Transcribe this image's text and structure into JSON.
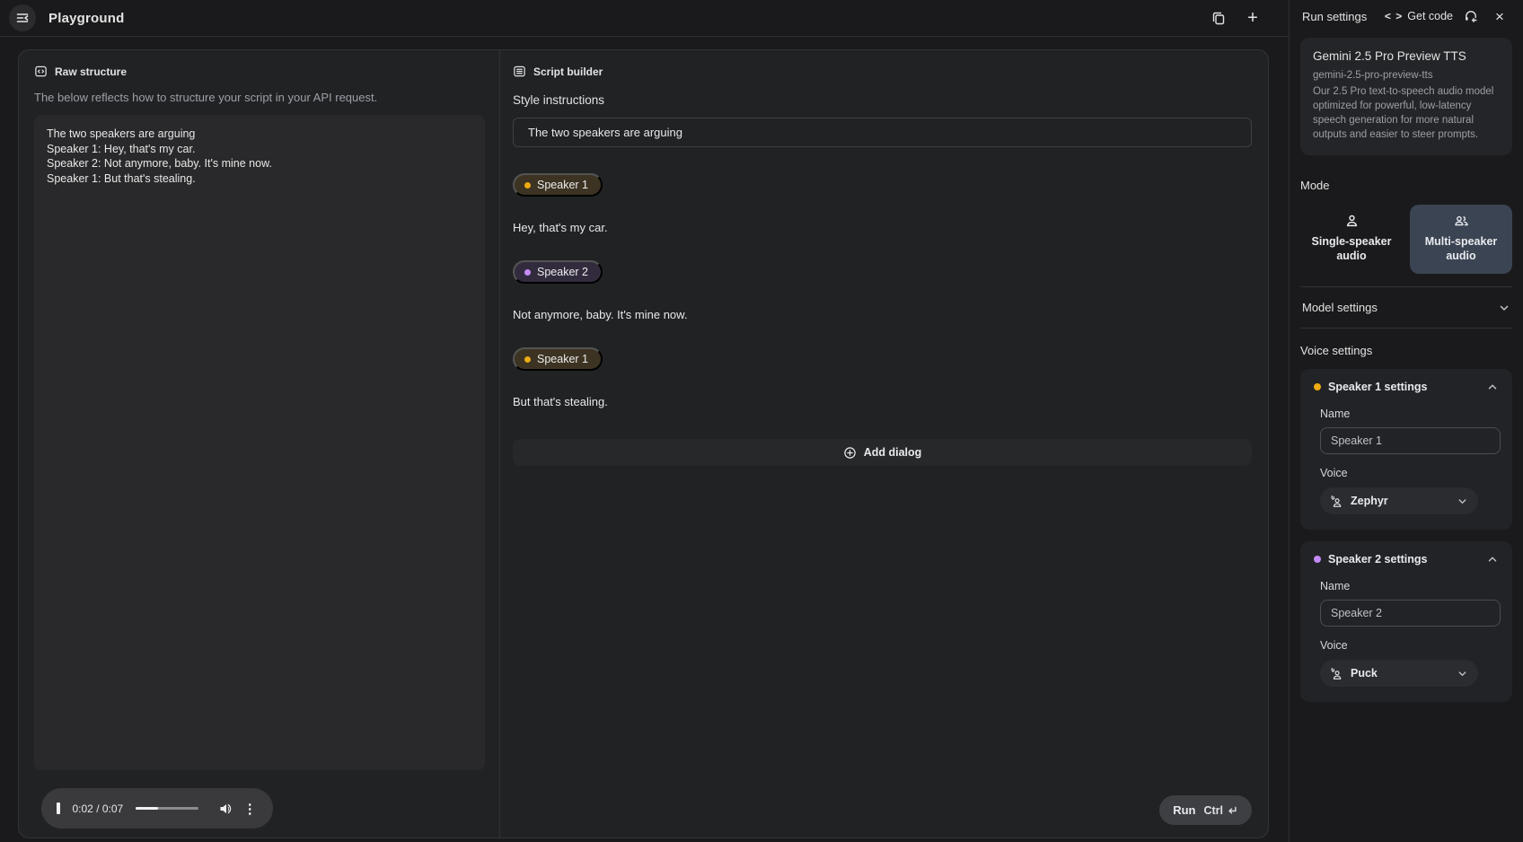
{
  "header": {
    "title": "Playground"
  },
  "raw_structure": {
    "title": "Raw structure",
    "description": "The below reflects how to structure your script in your API request.",
    "lines": [
      "The two speakers are arguing",
      "Speaker 1: Hey, that's my car.",
      "Speaker 2: Not anymore, baby. It's mine now.",
      "Speaker 1: But that's stealing."
    ]
  },
  "script_builder": {
    "title": "Script builder",
    "style_label": "Style instructions",
    "style_value": "The two speakers are arguing",
    "dialogs": [
      {
        "speaker": "Speaker 1",
        "color": "amber",
        "text": "Hey, that's my car."
      },
      {
        "speaker": "Speaker 2",
        "color": "purple",
        "text": "Not anymore, baby. It's mine now."
      },
      {
        "speaker": "Speaker 1",
        "color": "amber",
        "text": "But that's stealing."
      }
    ],
    "add_dialog_label": "Add dialog"
  },
  "player": {
    "time_display": "0:02 / 0:07",
    "current_time": "0:02",
    "duration": "0:07",
    "progress_percent": 36,
    "state": "playing"
  },
  "run_bar": {
    "run_label": "Run",
    "shortcut_key": "Ctrl"
  },
  "run_settings": {
    "title": "Run settings",
    "get_code_label": "Get code",
    "get_code_glyph": "< >",
    "model_card": {
      "name": "Gemini 2.5 Pro Preview TTS",
      "id": "gemini-2.5-pro-preview-tts",
      "description": "Our 2.5 Pro text-to-speech audio model optimized for powerful, low-latency speech generation for more natural outputs and easier to steer prompts."
    },
    "mode": {
      "label": "Mode",
      "options": [
        {
          "label": "Single-speaker audio",
          "selected": false
        },
        {
          "label": "Multi-speaker audio",
          "selected": true
        }
      ]
    },
    "model_settings_label": "Model settings",
    "voice_settings": {
      "label": "Voice settings",
      "speakers": [
        {
          "title": "Speaker 1 settings",
          "dot_color": "#edaa12",
          "name_label": "Name",
          "name_value": "Speaker 1",
          "voice_label": "Voice",
          "voice_value": "Zephyr",
          "expanded": true
        },
        {
          "title": "Speaker 2 settings",
          "dot_color": "#c58af9",
          "name_label": "Name",
          "name_value": "Speaker 2",
          "voice_label": "Voice",
          "voice_value": "Puck",
          "expanded": true
        }
      ]
    }
  },
  "colors": {
    "page_bg": "#1a1a1c",
    "panel_bg": "#212224",
    "code_block_bg": "#29292b",
    "selected_mode_bg": "#3b4453",
    "speaker1_dot": "#edaa12",
    "speaker2_dot": "#c58af9",
    "speaker1_chip_bg": "#3c3322",
    "speaker2_chip_bg": "#322b3e",
    "muted_text": "#9aa0a6"
  },
  "icons": {
    "plus": "+",
    "close": "×",
    "dots_vertical": "⋮",
    "get_code": "< >"
  }
}
